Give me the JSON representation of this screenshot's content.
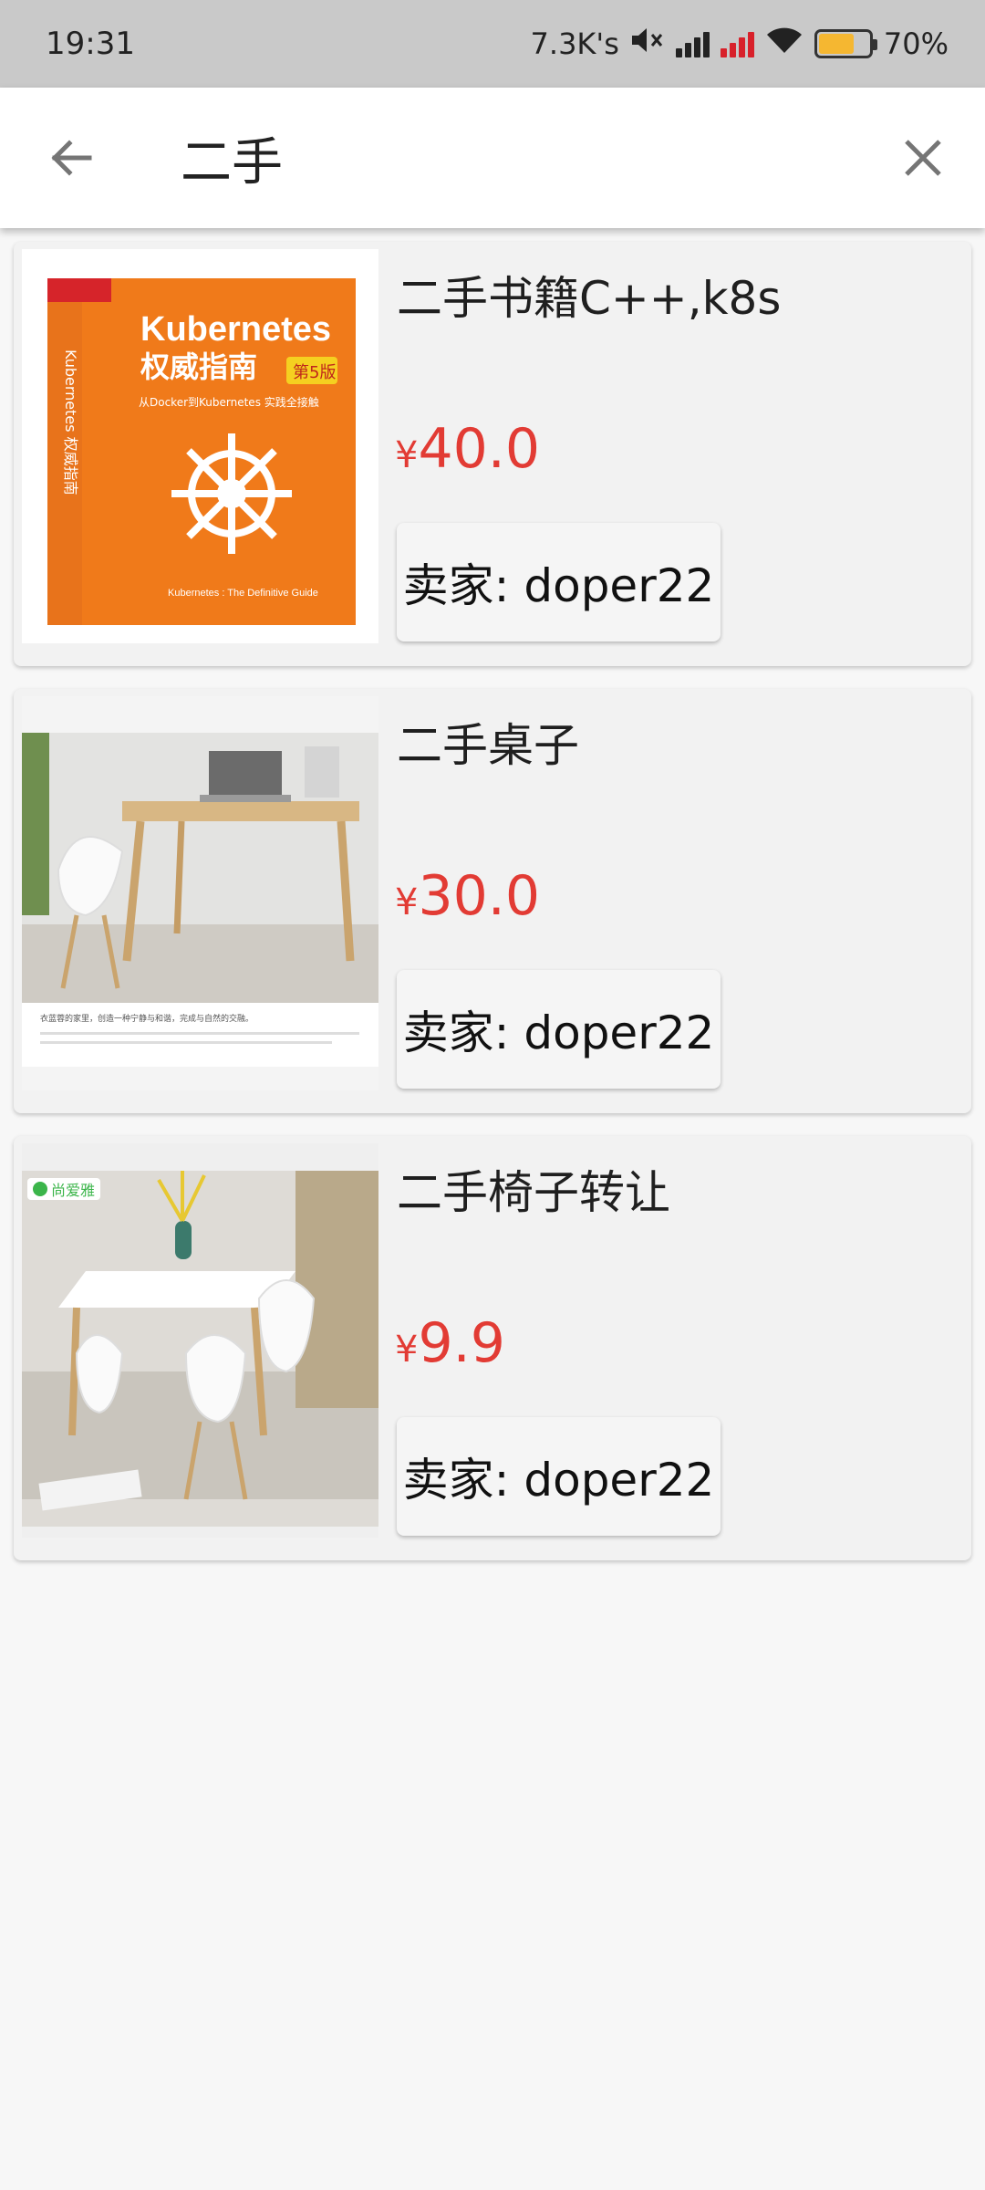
{
  "status_bar": {
    "time": "19:31",
    "speed": "7.3K's",
    "battery": "70%",
    "battery_level": 0.7,
    "battery_color": "#f5b731"
  },
  "search": {
    "query": "二手",
    "back_icon": "arrow-left-icon",
    "clear_icon": "close-icon"
  },
  "colors": {
    "price": "#e23b34",
    "header_bg": "#ffffff",
    "status_bg": "#c9c9c9"
  },
  "results": [
    {
      "title": "二手书籍C++,k8s",
      "currency": "¥",
      "price": "40.0",
      "seller": "卖家: doper22",
      "image": {
        "brand": "Kubernetes",
        "name": "权威指南",
        "badge": "第5版",
        "subtitle": "从Docker到Kubernetes 实践全接触",
        "spine": "Kubernetes 权威指南",
        "footer": "Kubernetes : The Definitive Guide"
      }
    },
    {
      "title": "二手桌子",
      "currency": "¥",
      "price": "30.0",
      "seller": "卖家: doper22",
      "image": {
        "caption": "衣蓝蓉的家里，创造一种宁静与和谐，完成与自然的交融。"
      }
    },
    {
      "title": "二手椅子转让",
      "currency": "¥",
      "price": "9.9",
      "seller": "卖家: doper22",
      "image": {
        "logo": "尚爱雅"
      }
    }
  ]
}
